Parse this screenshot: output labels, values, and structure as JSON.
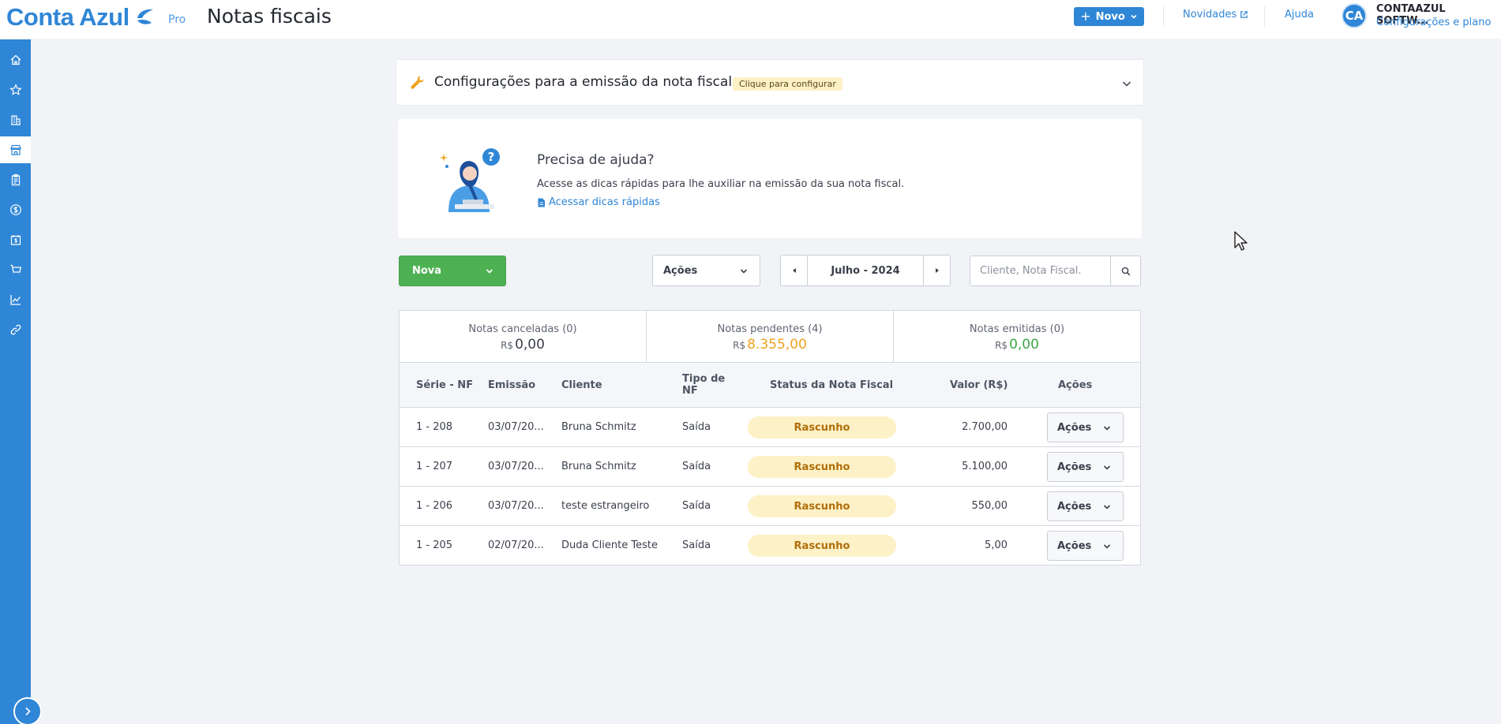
{
  "header": {
    "logo_text": "Conta Azul",
    "plan": "Pro",
    "page_title": "Notas fiscais",
    "novo_button": "Novo",
    "novidades": "Novidades",
    "ajuda": "Ajuda",
    "avatar_initials": "CA",
    "company_name": "CONTAAZUL SOFTW...",
    "config_plano": "Configurações e plano"
  },
  "sidebar": {
    "items": [
      {
        "icon": "home-icon"
      },
      {
        "icon": "star-icon"
      },
      {
        "icon": "building-icon"
      },
      {
        "icon": "store-icon",
        "active": true
      },
      {
        "icon": "clipboard-icon"
      },
      {
        "icon": "dollar-circle-icon"
      },
      {
        "icon": "calendar-dollar-icon"
      },
      {
        "icon": "cart-icon"
      },
      {
        "icon": "chart-line-icon"
      },
      {
        "icon": "link-icon"
      }
    ]
  },
  "config": {
    "title": "Configurações para a emissão da nota fiscal",
    "badge": "Clique para configurar"
  },
  "help": {
    "title": "Precisa de ajuda?",
    "text": "Acesse as dicas rápidas para lhe auxiliar na emissão da sua nota fiscal.",
    "link": "Acessar dicas rápidas"
  },
  "toolbar": {
    "nova_button": "Nova",
    "acoes_select": "Ações",
    "period": "Julho - 2024",
    "search_placeholder": "Cliente, Nota Fiscal."
  },
  "summary": [
    {
      "label": "Notas canceladas (0)",
      "currency": "R$",
      "value": "0,00",
      "color": "#3a3f4b"
    },
    {
      "label": "Notas pendentes (4)",
      "currency": "R$",
      "value": "8.355,00",
      "color": "#f0a21f"
    },
    {
      "label": "Notas emitidas (0)",
      "currency": "R$",
      "value": "0,00",
      "color": "#3aa646"
    }
  ],
  "table": {
    "headers": {
      "serie": "Série - NF",
      "emissao": "Emissão",
      "cliente": "Cliente",
      "tipo_1": "Tipo de",
      "tipo_2": "NF",
      "status": "Status da Nota Fiscal",
      "valor": "Valor (R$)",
      "acoes": "Ações"
    },
    "rows": [
      {
        "serie": "1 - 208",
        "emissao": "03/07/20...",
        "cliente": "Bruna Schmitz",
        "tipo": "Saída",
        "status": "Rascunho",
        "valor": "2.700,00",
        "acoes": "Ações"
      },
      {
        "serie": "1 - 207",
        "emissao": "03/07/20...",
        "cliente": "Bruna Schmitz",
        "tipo": "Saída",
        "status": "Rascunho",
        "valor": "5.100,00",
        "acoes": "Ações"
      },
      {
        "serie": "1 - 206",
        "emissao": "03/07/20...",
        "cliente": "teste estrangeiro",
        "tipo": "Saída",
        "status": "Rascunho",
        "valor": "550,00",
        "acoes": "Ações"
      },
      {
        "serie": "1 - 205",
        "emissao": "02/07/20...",
        "cliente": "Duda Cliente Teste",
        "tipo": "Saída",
        "status": "Rascunho",
        "valor": "5,00",
        "acoes": "Ações"
      }
    ]
  },
  "colors": {
    "brand": "#2f86d6",
    "green": "#4db153",
    "draft_bg": "#fdf1c7",
    "draft_text": "#b06e0a"
  }
}
